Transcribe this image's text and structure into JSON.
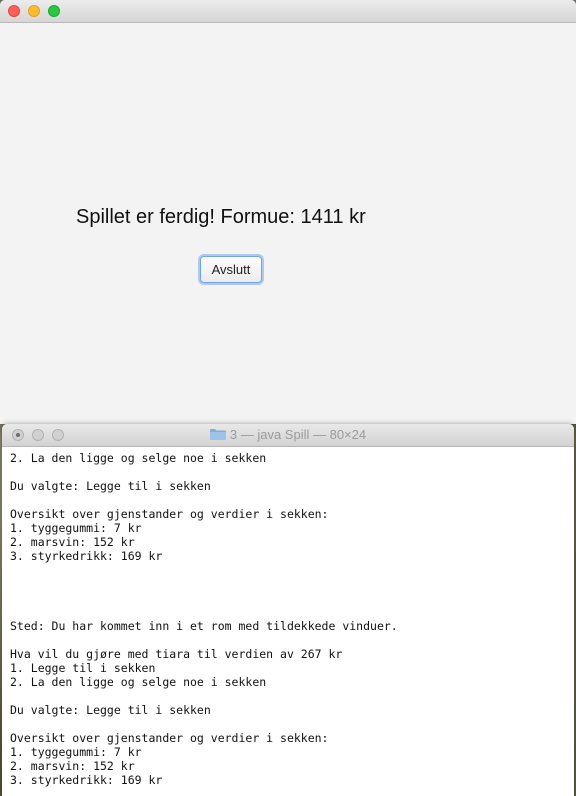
{
  "app": {
    "result_text": "Spillet er ferdig! Formue: 1411 kr",
    "exit_button_label": "Avslutt"
  },
  "terminal": {
    "title": "3 — java Spill — 80×24",
    "lines": [
      "2. La den ligge og selge noe i sekken",
      "",
      "Du valgte: Legge til i sekken",
      "",
      "Oversikt over gjenstander og verdier i sekken:",
      "1. tyggegummi: 7 kr",
      "2. marsvin: 152 kr",
      "3. styrkedrikk: 169 kr",
      "",
      "",
      "",
      "",
      "Sted: Du har kommet inn i et rom med tildekkede vinduer.",
      "",
      "Hva vil du gjøre med tiara til verdien av 267 kr",
      "1. Legge til i sekken",
      "2. La den ligge og selge noe i sekken",
      "",
      "Du valgte: Legge til i sekken",
      "",
      "Oversikt over gjenstander og verdier i sekken:",
      "1. tyggegummi: 7 kr",
      "2. marsvin: 152 kr",
      "3. styrkedrikk: 169 kr"
    ],
    "icon": "folder-icon"
  },
  "colors": {
    "close": "#fc5f57",
    "minimize": "#fdbc2e",
    "maximize": "#28c840",
    "focus_ring": "#6fa4e6"
  }
}
